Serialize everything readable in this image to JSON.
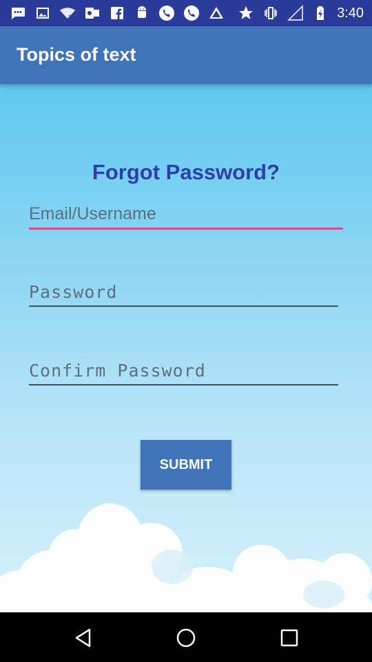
{
  "status_bar": {
    "time": "3:40",
    "icons_left": [
      "chat-icon",
      "image-icon",
      "wifi-unknown-icon",
      "outlook-icon",
      "facebook-icon",
      "android-icon",
      "phone-icon",
      "phone-icon",
      "delta-icon"
    ],
    "icons_right": [
      "star-icon",
      "vibrate-icon",
      "signal-empty-icon",
      "battery-charging-icon"
    ]
  },
  "app_bar": {
    "title": "Topics of text"
  },
  "form": {
    "heading": "Forgot Password?",
    "email_placeholder": "Email/Username",
    "password_placeholder": "Password",
    "confirm_placeholder": "Confirm Password",
    "submit_label": "SUBMIT"
  },
  "colors": {
    "status_bar": "#2a3b9a",
    "app_bar": "#3f75b8",
    "heading": "#2f3fa8",
    "focused_underline": "#d64c8c",
    "button": "#3f75b8"
  }
}
